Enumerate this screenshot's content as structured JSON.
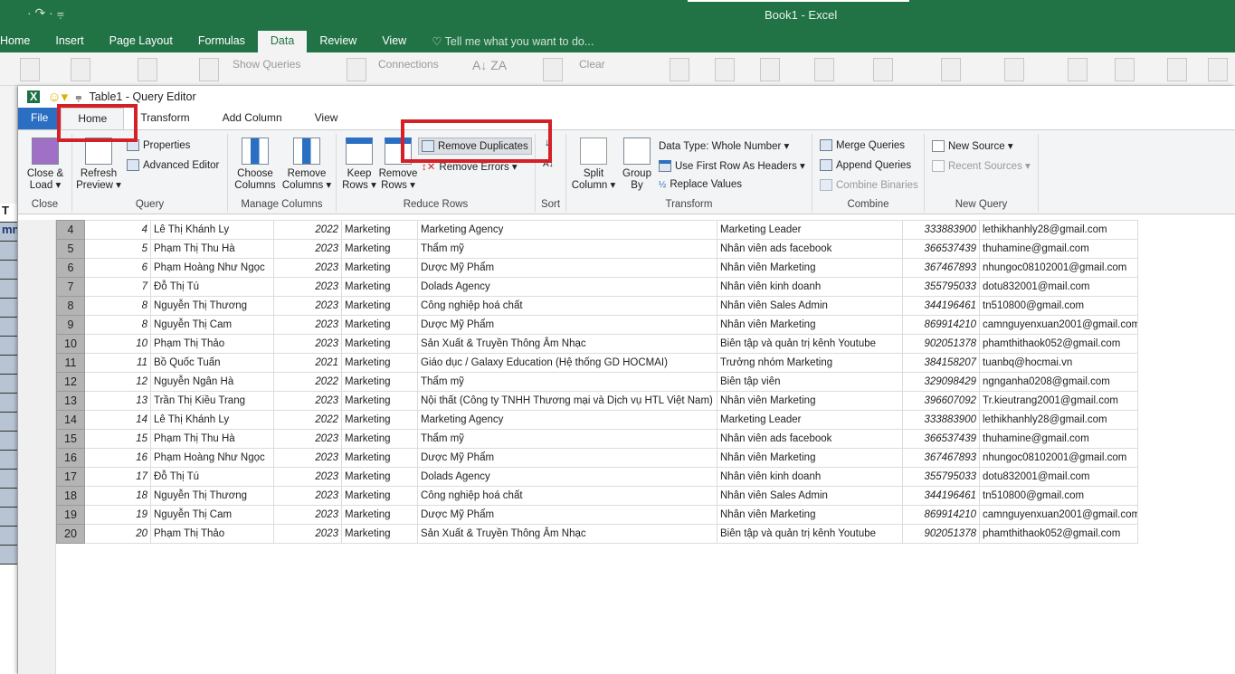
{
  "excel": {
    "title": "Book1 - Excel",
    "tabs": [
      "Home",
      "Insert",
      "Page Layout",
      "Formulas",
      "Data",
      "Review",
      "View"
    ],
    "active_tab": "Data",
    "tell_me": "Tell me what you want to do...",
    "ribbon": {
      "show_queries": "Show Queries",
      "connections": "Connections",
      "clear": "Clear"
    },
    "left_cells": [
      "T",
      "mn"
    ]
  },
  "query_editor": {
    "title": "Table1 - Query Editor",
    "tabs": [
      "File",
      "Home",
      "Transform",
      "Add Column",
      "View"
    ],
    "active_tab": "Home",
    "ribbon": {
      "close": {
        "label": "Close",
        "close_load": "Close &",
        "close_load2": "Load ▾"
      },
      "query": {
        "label": "Query",
        "refresh": "Refresh",
        "refresh2": "Preview ▾",
        "properties": "Properties",
        "advanced_editor": "Advanced Editor"
      },
      "manage_columns": {
        "label": "Manage Columns",
        "choose": "Choose",
        "choose2": "Columns",
        "remove": "Remove",
        "remove2": "Columns ▾"
      },
      "reduce_rows": {
        "label": "Reduce Rows",
        "keep": "Keep",
        "keep2": "Rows ▾",
        "remove": "Remove",
        "remove2": "Rows ▾",
        "remove_duplicates": "Remove Duplicates",
        "remove_errors": "Remove Errors ▾"
      },
      "sort": {
        "label": "Sort"
      },
      "transform": {
        "label": "Transform",
        "split": "Split",
        "split2": "Column ▾",
        "group": "Group",
        "group2": "By",
        "data_type": "Data Type: Whole Number ▾",
        "first_row": "Use First Row As Headers ▾",
        "replace": "Replace Values"
      },
      "combine": {
        "label": "Combine",
        "merge": "Merge Queries",
        "append": "Append Queries",
        "binaries": "Combine Binaries"
      },
      "new_query": {
        "label": "New Query",
        "new_source": "New Source ▾",
        "recent_sources": "Recent Sources ▾"
      }
    },
    "highlight_color": "#d42027",
    "rows": [
      [
        "4",
        "4",
        "Lê Thị Khánh Ly",
        "2022",
        "Marketing",
        "Marketing Agency",
        "Marketing Leader",
        "333883900",
        "lethikhanhly28@gmail.com"
      ],
      [
        "5",
        "5",
        "Phạm Thị Thu Hà",
        "2023",
        "Marketing",
        "Thẩm mỹ",
        "Nhân viên ads facebook",
        "366537439",
        "thuhamine@gmail.com"
      ],
      [
        "6",
        "6",
        "Phạm Hoàng Như Ngọc",
        "2023",
        "Marketing",
        "Dược Mỹ Phẩm",
        "Nhân viên Marketing",
        "367467893",
        "nhungoc08102001@gmail.com"
      ],
      [
        "7",
        "7",
        "Đỗ Thị Tú",
        "2023",
        "Marketing",
        "Dolads Agency",
        "Nhân viên kinh doanh",
        "355795033",
        "dotu832001@mail.com"
      ],
      [
        "8",
        "8",
        "Nguyễn Thị Thương",
        "2023",
        "Marketing",
        "Công nghiệp hoá chất",
        "Nhân viên Sales Admin",
        "344196461",
        "tn510800@gmail.com"
      ],
      [
        "9",
        "8",
        "Nguyễn Thị Cam",
        "2023",
        "Marketing",
        "Dược Mỹ Phẩm",
        "Nhân viên Marketing",
        "869914210",
        "camnguyenxuan2001@gmail.com"
      ],
      [
        "10",
        "10",
        "Phạm Thị Thảo",
        "2023",
        "Marketing",
        "Sản Xuất & Truyền Thông Âm Nhạc",
        "Biên tập và quản trị kênh Youtube",
        "902051378",
        "phamthithaok052@gmail.com"
      ],
      [
        "11",
        "11",
        "Bồ Quốc Tuấn",
        "2021",
        "Marketing",
        "Giáo dục / Galaxy Education (Hệ thống GD HOCMAI)",
        "Trưởng nhóm Marketing",
        "384158207",
        "tuanbq@hocmai.vn"
      ],
      [
        "12",
        "12",
        "Nguyễn Ngân Hà",
        "2022",
        "Marketing",
        "Thẩm mỹ",
        "Biên tập viên",
        "329098429",
        "ngnganha0208@gmail.com"
      ],
      [
        "13",
        "13",
        "Trần Thị Kiều Trang",
        "2023",
        "Marketing",
        "Nội thất (Công ty TNHH Thương mại và Dịch vụ HTL Việt Nam)",
        "Nhân viên Marketing",
        "396607092",
        "Tr.kieutrang2001@gmail.com"
      ],
      [
        "14",
        "14",
        "Lê Thị Khánh Ly",
        "2022",
        "Marketing",
        "Marketing Agency",
        "Marketing Leader",
        "333883900",
        "lethikhanhly28@gmail.com"
      ],
      [
        "15",
        "15",
        "Phạm Thị Thu Hà",
        "2023",
        "Marketing",
        "Thẩm mỹ",
        "Nhân viên ads facebook",
        "366537439",
        "thuhamine@gmail.com"
      ],
      [
        "16",
        "16",
        "Phạm Hoàng Như Ngọc",
        "2023",
        "Marketing",
        "Dược Mỹ Phẩm",
        "Nhân viên Marketing",
        "367467893",
        "nhungoc08102001@gmail.com"
      ],
      [
        "17",
        "17",
        "Đỗ Thị Tú",
        "2023",
        "Marketing",
        "Dolads Agency",
        "Nhân viên kinh doanh",
        "355795033",
        "dotu832001@mail.com"
      ],
      [
        "18",
        "18",
        "Nguyễn Thị Thương",
        "2023",
        "Marketing",
        "Công nghiệp hoá chất",
        "Nhân viên Sales Admin",
        "344196461",
        "tn510800@gmail.com"
      ],
      [
        "19",
        "19",
        "Nguyễn Thị Cam",
        "2023",
        "Marketing",
        "Dược Mỹ Phẩm",
        "Nhân viên Marketing",
        "869914210",
        "camnguyenxuan2001@gmail.com"
      ],
      [
        "20",
        "20",
        "Phạm Thị Thảo",
        "2023",
        "Marketing",
        "Sản Xuất & Truyền Thông Âm Nhạc",
        "Biên tập và quản trị kênh Youtube",
        "902051378",
        "phamthithaok052@gmail.com"
      ]
    ]
  }
}
